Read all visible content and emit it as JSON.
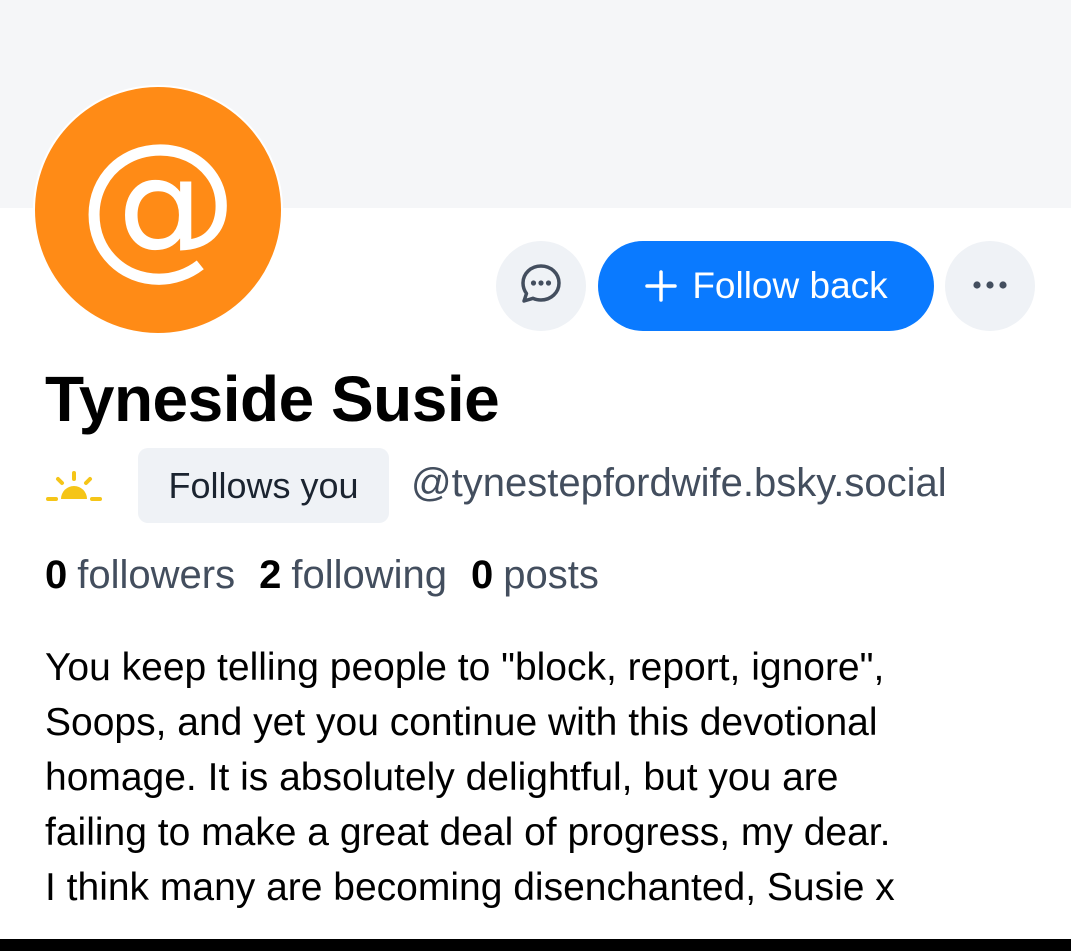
{
  "colors": {
    "banner": "#f5f6f8",
    "avatar": "#ff8b16",
    "accent": "#0a7aff",
    "muted_text": "#434e5e",
    "button_bg": "#eff2f6"
  },
  "profile": {
    "avatar_glyph": "@",
    "display_name": "Tyneside Susie",
    "handle": "@tynestepfordwife.bsky.social",
    "follows_you_label": "Follows you",
    "status_icon": "sun-icon"
  },
  "actions": {
    "message_icon": "message-icon",
    "follow_back_label": "Follow back",
    "more_icon": "more-icon"
  },
  "stats": {
    "followers_count": "0",
    "followers_label": "followers",
    "following_count": "2",
    "following_label": "following",
    "posts_count": "0",
    "posts_label": "posts"
  },
  "bio": {
    "lines": [
      "You keep telling people to \"block, report, ignore\",",
      "Soops, and yet you continue with this devotional",
      "homage. It is absolutely delightful, but you are",
      "failing to make a great deal of progress, my dear.",
      "I think many are becoming disenchanted, Susie x"
    ]
  }
}
